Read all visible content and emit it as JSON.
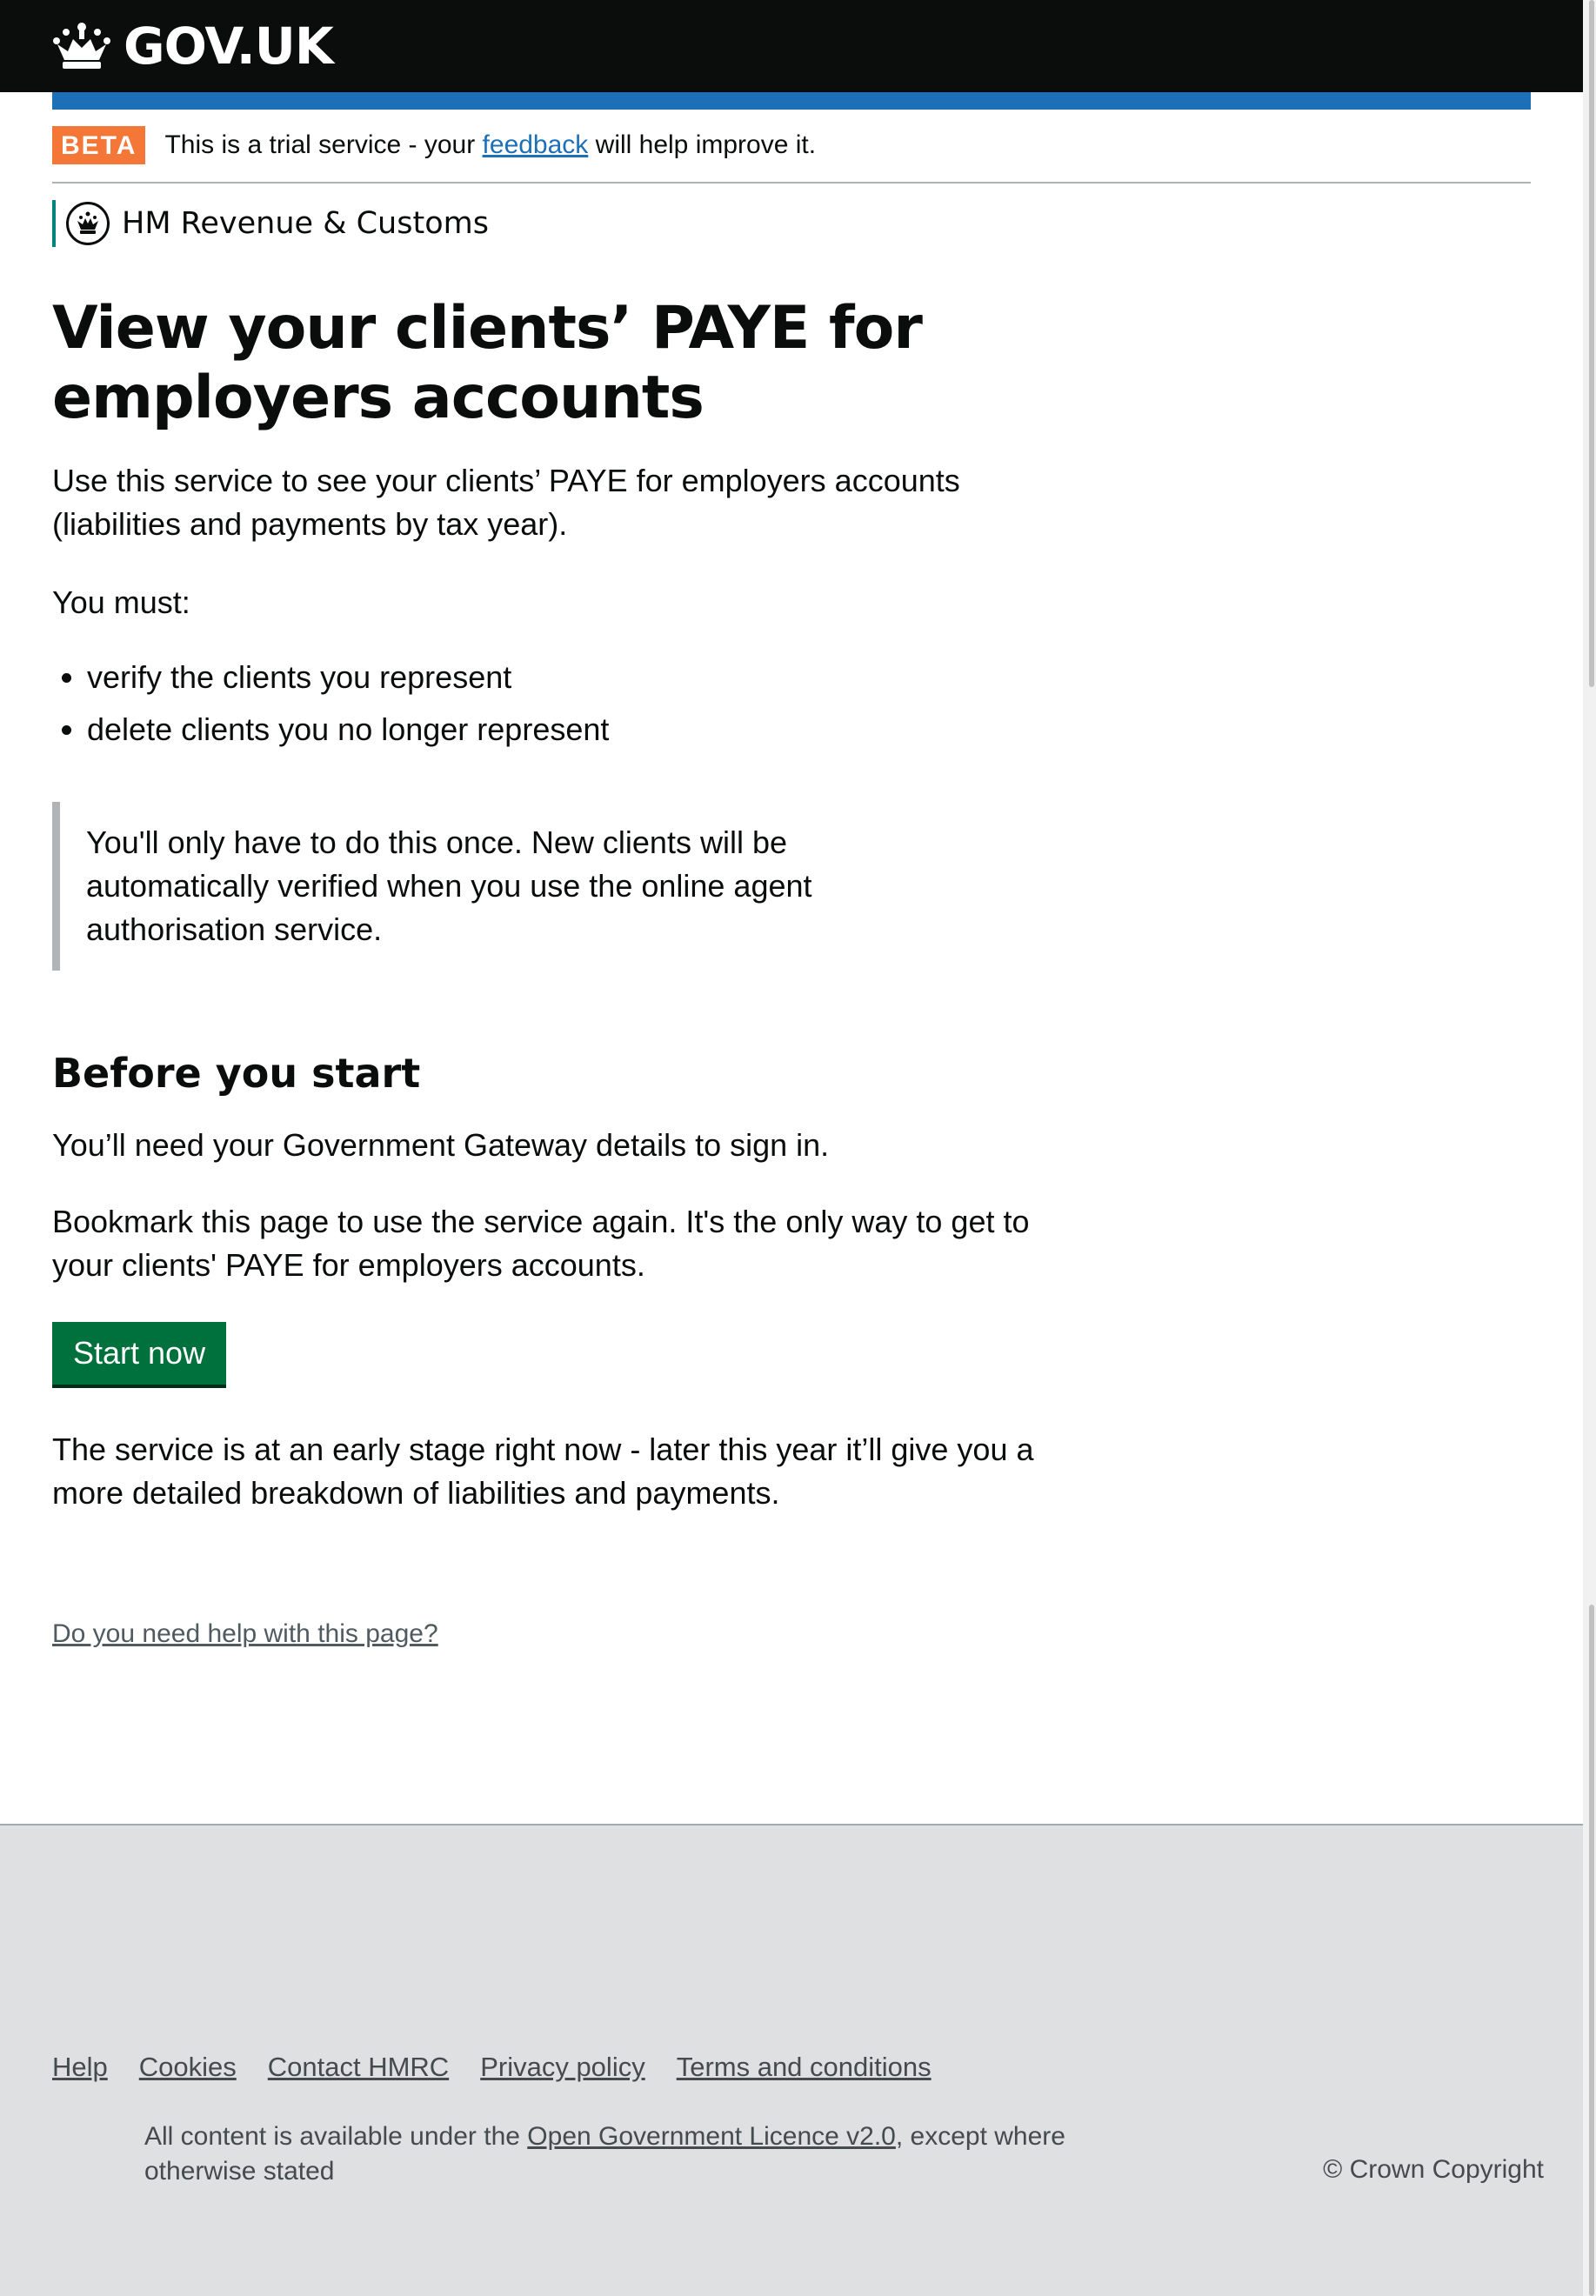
{
  "header": {
    "logo_text": "GOV.UK",
    "icon": "crown-icon"
  },
  "phase_banner": {
    "tag": "BETA",
    "text_before": "This is a trial service - your",
    "link": "feedback",
    "text_after": "will help improve it."
  },
  "organisation": {
    "name": "HM Revenue & Customs",
    "icon": "hmrc-crest-icon",
    "accent_color": "#00857e"
  },
  "main": {
    "title": "View your clients’ PAYE for employers accounts",
    "intro": "Use this service to see your clients’ PAYE for employers accounts (liabilities and payments by tax year).",
    "must_label": "You must:",
    "must_items": [
      "verify the clients you represent",
      "delete clients you no longer represent"
    ],
    "inset": "You'll only have to do this once. New clients will be automatically verified when you use the online agent authorisation service.",
    "before_heading": "Before you start",
    "gateway": "You’ll need your Government Gateway details to sign in.",
    "bookmark": "Bookmark this page to use the service again. It's the only way to get to your clients' PAYE for employers accounts.",
    "start_button": "Start now",
    "early_stage": "The service is at an early stage right now - later this year it’ll give you a more detailed breakdown of liabilities and payments.",
    "help_link": "Do you need help with this page?"
  },
  "footer": {
    "links": [
      "Help",
      "Cookies",
      "Contact HMRC",
      "Privacy policy",
      "Terms and conditions"
    ],
    "licence_before": "All content is available under the",
    "licence_link": "Open Government Licence v2.0",
    "licence_after": ", except where otherwise stated",
    "copyright": "© Crown Copyright"
  },
  "colors": {
    "header_bg": "#0b0c0c",
    "blue_bar": "#1d70b8",
    "beta_tag": "#f47738",
    "start_button": "#00703c",
    "footer_bg": "#dee0e2"
  }
}
